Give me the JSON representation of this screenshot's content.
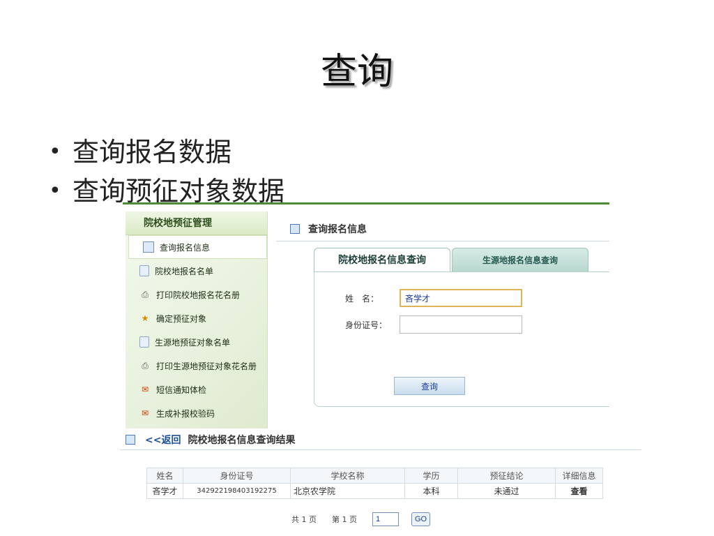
{
  "slide": {
    "title": "查询",
    "bullets": [
      "查询报名数据",
      "查询预征对象数据"
    ]
  },
  "sidebar": {
    "title": "院校地预征管理",
    "items": [
      {
        "label": "查询报名信息",
        "icon": "list-icon"
      },
      {
        "label": "院校地报名名单",
        "icon": "document-icon"
      },
      {
        "label": "打印院校地报名花名册",
        "icon": "printer-icon"
      },
      {
        "label": "确定预征对象",
        "icon": "medal-icon"
      },
      {
        "label": "生源地预征对象名单",
        "icon": "document-icon"
      },
      {
        "label": "打印生源地预征对象花名册",
        "icon": "printer-icon"
      },
      {
        "label": "短信通知体检",
        "icon": "sms-icon"
      },
      {
        "label": "生成补报校验码",
        "icon": "sms-icon"
      }
    ]
  },
  "panel": {
    "title": "查询报名信息",
    "tabs": [
      "院校地报名信息查询",
      "生源地报名信息查询"
    ],
    "form": {
      "name_label": "姓　名：",
      "name_value": "吝学才",
      "id_label": "身份证号：",
      "id_value": "",
      "submit_label": "查询"
    }
  },
  "results": {
    "back_label": "<<返回",
    "title": "院校地报名信息查询结果",
    "columns": [
      "姓名",
      "身份证号",
      "学校名称",
      "学历",
      "预征结论",
      "详细信息"
    ],
    "rows": [
      [
        "吝学才",
        "342922198403192275",
        "北京农学院",
        "本科",
        "未通过",
        "查看"
      ]
    ],
    "pager": {
      "total": "共 1 页",
      "current": "第 1 页",
      "page_input": "1",
      "go_label": "GO"
    }
  },
  "colors": {
    "sidebar_accent": "#4d8a3a",
    "link": "#1d4f9a",
    "tab_border": "#9fc3b9"
  }
}
